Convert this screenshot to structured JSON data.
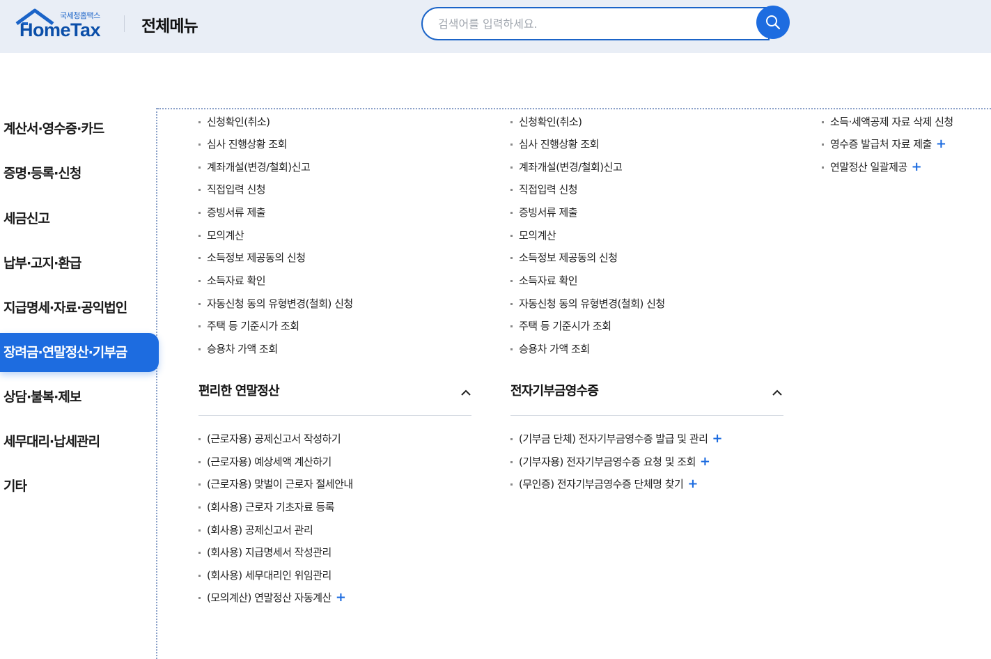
{
  "header": {
    "logo_small": "국세청홈택스",
    "logo_main": "HomeTax",
    "title": "전체메뉴",
    "search_placeholder": "검색어를 입력하세요."
  },
  "sidebar": {
    "items": [
      {
        "label": "계산서·영수증·카드",
        "active": false
      },
      {
        "label": "증명·등록·신청",
        "active": false
      },
      {
        "label": "세금신고",
        "active": false
      },
      {
        "label": "납부·고지·환급",
        "active": false
      },
      {
        "label": "지급명세·자료·공익법인",
        "active": false
      },
      {
        "label": "장려금·연말정산·기부금",
        "active": true
      },
      {
        "label": "상담·불복·제보",
        "active": false
      },
      {
        "label": "세무대리·납세관리",
        "active": false
      },
      {
        "label": "기타",
        "active": false
      }
    ]
  },
  "columns": {
    "col1_top": [
      "신청확인(취소)",
      "심사 진행상황 조회",
      "계좌개설(변경/철회)신고",
      "직접입력 신청",
      "증빙서류 제출",
      "모의계산",
      "소득정보 제공동의 신청",
      "소득자료 확인",
      "자동신청 동의 유형변경(철회) 신청",
      "주택 등 기준시가 조회",
      "승용차 가액 조회"
    ],
    "col2_top": [
      "신청확인(취소)",
      "심사 진행상황 조회",
      "계좌개설(변경/철회)신고",
      "직접입력 신청",
      "증빙서류 제출",
      "모의계산",
      "소득정보 제공동의 신청",
      "소득자료 확인",
      "자동신청 동의 유형변경(철회) 신청",
      "주택 등 기준시가 조회",
      "승용차 가액 조회"
    ],
    "col3_top": [
      {
        "label": "소득·세액공제 자료 삭제 신청",
        "plus": false
      },
      {
        "label": "영수증 발급처 자료 제출",
        "plus": true
      },
      {
        "label": "연말정산 일괄제공",
        "plus": true
      }
    ],
    "section1": {
      "title": "편리한 연말정산",
      "items": [
        {
          "label": "(근로자용) 공제신고서 작성하기",
          "plus": false
        },
        {
          "label": "(근로자용) 예상세액 계산하기",
          "plus": false
        },
        {
          "label": "(근로자용) 맞벌이 근로자 절세안내",
          "plus": false
        },
        {
          "label": "(회사용) 근로자 기초자료 등록",
          "plus": false
        },
        {
          "label": "(회사용) 공제신고서 관리",
          "plus": false
        },
        {
          "label": "(회사용) 지급명세서 작성관리",
          "plus": false
        },
        {
          "label": "(회사용) 세무대리인 위임관리",
          "plus": false
        },
        {
          "label": "(모의계산) 연말정산 자동계산",
          "plus": true
        }
      ]
    },
    "section2": {
      "title": "전자기부금영수증",
      "items": [
        {
          "label": "(기부금 단체) 전자기부금영수증 발급 및 관리",
          "plus": true
        },
        {
          "label": "(기부자용) 전자기부금영수증 요청 및 조회",
          "plus": true
        },
        {
          "label": "(무인증) 전자기부금영수증 단체명 찾기",
          "plus": true
        }
      ]
    },
    "plus_symbol": "+"
  },
  "colors": {
    "accent": "#1d6ce0",
    "header_bg": "#e9eef6"
  }
}
